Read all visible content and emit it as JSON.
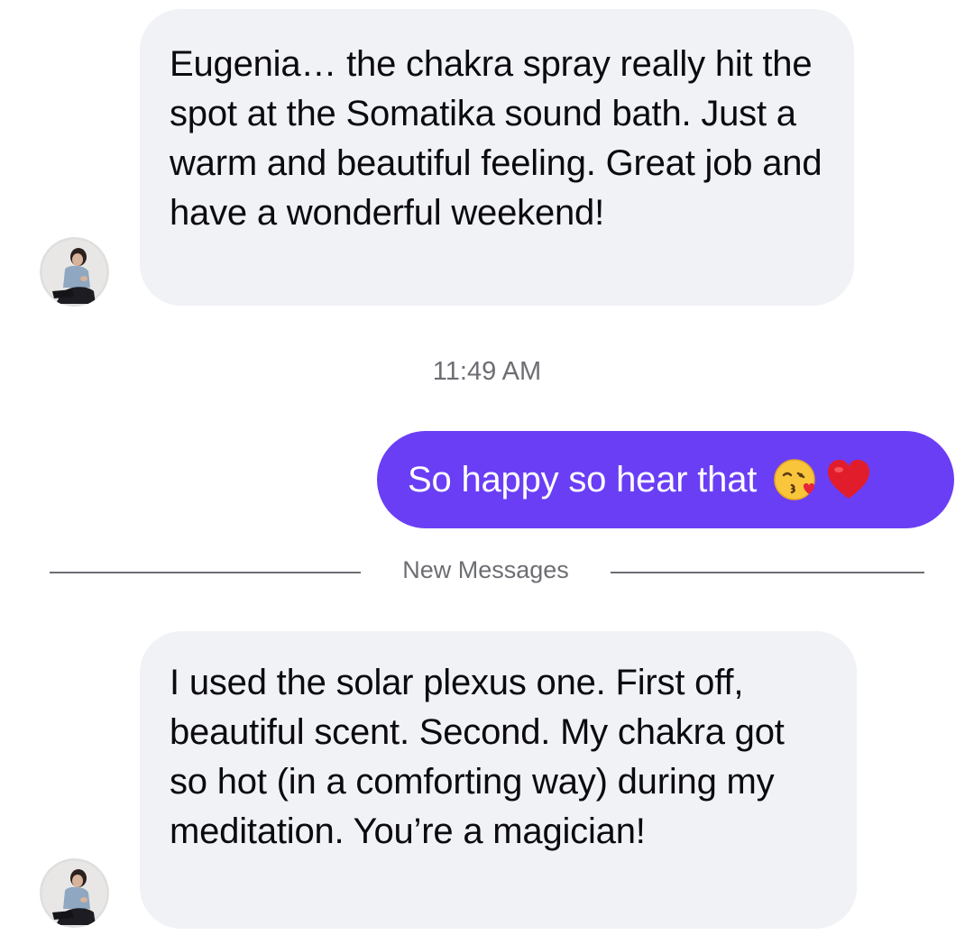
{
  "messages": {
    "first": {
      "text": "Eugenia… the chakra spray really hit the spot at the Somatika sound bath. Just a warm and beautiful feeling. Great job and have a wonderful weekend!"
    },
    "timestamp": "11:49 AM",
    "reply": {
      "text": "So happy so hear that",
      "emojis": [
        "kissing-face-with-heart",
        "red-heart"
      ]
    },
    "divider": {
      "label": "New Messages"
    },
    "second": {
      "text": "I used the solar plexus one. First off, beautiful scent. Second. My chakra got so hot (in a comforting way) during my meditation. You’re a magician!"
    }
  },
  "colors": {
    "incoming_bubble": "#f1f2f6",
    "outgoing_bubble": "#6a3ef5",
    "text_dark": "#0b0b0f",
    "text_muted": "#6d6e73"
  }
}
